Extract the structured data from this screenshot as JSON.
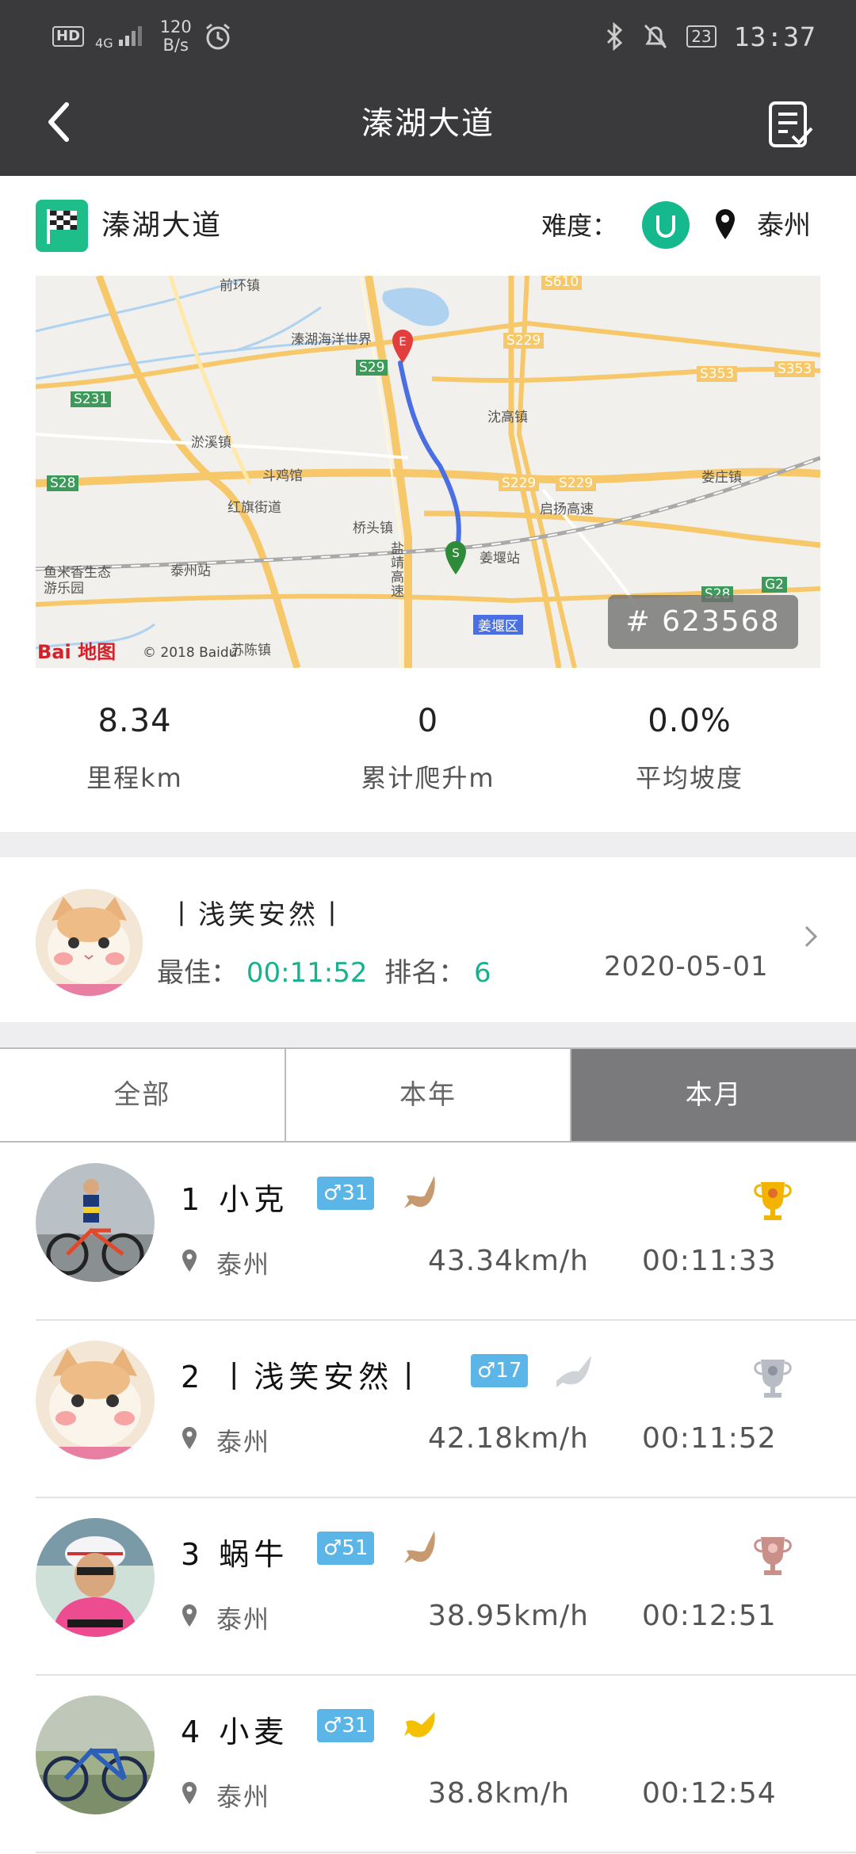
{
  "status_bar": {
    "hd": "HD",
    "network": "4G",
    "speed_value": "120",
    "speed_unit": "B/s",
    "battery": "23",
    "time": "13:37"
  },
  "header": {
    "title": "溱湖大道"
  },
  "route": {
    "name": "溱湖大道",
    "difficulty_label": "难度：",
    "city": "泰州",
    "route_id": "# 623568"
  },
  "map": {
    "labels": [
      "前环镇",
      "溱湖海洋世界",
      "沈高镇",
      "淤溪镇",
      "斗鸡馆",
      "红旗街道",
      "桥头镇",
      "启扬高速",
      "姜堰站",
      "姜堰区",
      "泰州站",
      "鱼米香生态",
      "游乐园",
      "娄庄镇",
      "苏陈镇",
      "盐靖高速"
    ],
    "road_codes": [
      "S610",
      "S229",
      "S353",
      "S353",
      "S29",
      "S231",
      "S28",
      "S229",
      "S229",
      "S28",
      "G2"
    ],
    "start_marker": "S",
    "end_marker": "E",
    "logo": "Bai 地图",
    "copyright": "© 2018 Baidu"
  },
  "stats": [
    {
      "value": "8.34",
      "label": "里程km"
    },
    {
      "value": "0",
      "label": "累计爬升m"
    },
    {
      "value": "0.0%",
      "label": "平均坡度"
    }
  ],
  "personal_best": {
    "name": "丨浅笑安然丨",
    "best_label": "最佳：",
    "best_time": "00:11:52",
    "rank_label": "排名：",
    "rank": "6",
    "date": "2020-05-01"
  },
  "tabs": [
    "全部",
    "本年",
    "本月"
  ],
  "active_tab": "本月",
  "leaderboard": [
    {
      "rank": "1",
      "name": "小克",
      "level": "♂31",
      "city": "泰州",
      "speed": "43.34km/h",
      "time": "00:11:33"
    },
    {
      "rank": "2",
      "name": "丨浅笑安然丨",
      "level": "♂17",
      "city": "泰州",
      "speed": "42.18km/h",
      "time": "00:11:52"
    },
    {
      "rank": "3",
      "name": "蜗牛",
      "level": "♂51",
      "city": "泰州",
      "speed": "38.95km/h",
      "time": "00:12:51"
    },
    {
      "rank": "4",
      "name": "小麦",
      "level": "♂31",
      "city": "泰州",
      "speed": "38.8km/h",
      "time": "00:12:54"
    }
  ],
  "colors": {
    "accent": "#17b18f",
    "bar": "#3a3a3c",
    "level_badge": "#5bb5e6",
    "gold": "#f2b400",
    "silver": "#b8bcc4",
    "bronze": "#c9908a"
  }
}
